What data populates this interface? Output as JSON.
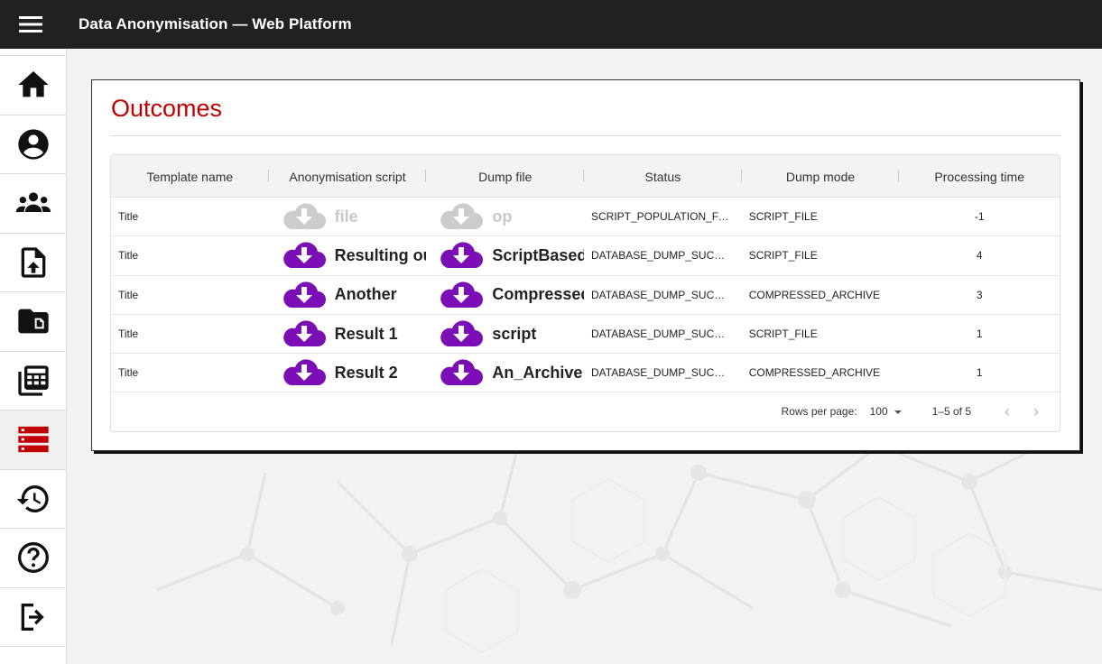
{
  "app": {
    "title": "Data Anonymisation — Web Platform"
  },
  "sidebar": {
    "items": [
      {
        "icon": "home-icon"
      },
      {
        "icon": "account-circle-icon"
      },
      {
        "icon": "groups-icon"
      },
      {
        "icon": "file-upload-icon"
      },
      {
        "icon": "folder-file-icon"
      },
      {
        "icon": "calculator-stack-icon"
      },
      {
        "icon": "storage-icon",
        "active": true
      },
      {
        "icon": "history-icon"
      },
      {
        "icon": "help-icon"
      },
      {
        "icon": "logout-icon"
      }
    ]
  },
  "page": {
    "title": "Outcomes"
  },
  "table": {
    "columns": [
      "Template name",
      "Anonymisation script",
      "Dump file",
      "Status",
      "Dump mode",
      "Processing time"
    ],
    "rows": [
      {
        "template": "Title",
        "script": "file",
        "script_enabled": false,
        "dump": "op",
        "dump_enabled": false,
        "status": "SCRIPT_POPULATION_FAIL...",
        "mode": "SCRIPT_FILE",
        "time": "-1"
      },
      {
        "template": "Title",
        "script": "Resulting ou",
        "script_enabled": true,
        "dump": "ScriptBased",
        "dump_enabled": true,
        "status": "DATABASE_DUMP_SUCCESS",
        "mode": "SCRIPT_FILE",
        "time": "4"
      },
      {
        "template": "Title",
        "script": "Another",
        "script_enabled": true,
        "dump": "Compressed",
        "dump_enabled": true,
        "status": "DATABASE_DUMP_SUCCESS",
        "mode": "COMPRESSED_ARCHIVE",
        "time": "3"
      },
      {
        "template": "Title",
        "script": "Result 1",
        "script_enabled": true,
        "dump": "script",
        "dump_enabled": true,
        "status": "DATABASE_DUMP_SUCCESS",
        "mode": "SCRIPT_FILE",
        "time": "1"
      },
      {
        "template": "Title",
        "script": "Result 2",
        "script_enabled": true,
        "dump": "An_Archive",
        "dump_enabled": true,
        "status": "DATABASE_DUMP_SUCCESS",
        "mode": "COMPRESSED_ARCHIVE",
        "time": "1"
      }
    ]
  },
  "pagination": {
    "rows_per_page_label": "Rows per page:",
    "rows_per_page": "100",
    "range": "1–5 of 5"
  },
  "colors": {
    "accent": "#c00000",
    "download": "#7b0fb5",
    "download_disabled": "#cccccc",
    "topbar": "#212121"
  }
}
